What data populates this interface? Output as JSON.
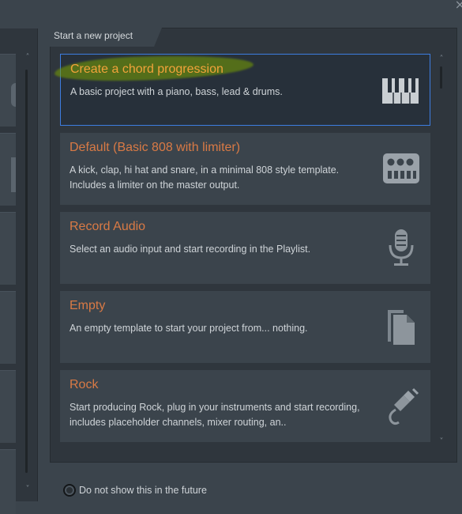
{
  "window": {
    "close_glyph": "×"
  },
  "panel": {
    "tab_title": "Start a new project"
  },
  "templates": [
    {
      "title": "Create a chord progression",
      "description": "A basic project with a piano, bass, lead & drums.",
      "icon": "piano-icon",
      "selected": true
    },
    {
      "title": "Default (Basic 808 with limiter)",
      "description": "A kick, clap, hi hat and snare, in a minimal 808 style template. Includes a limiter on the master output.",
      "icon": "drum-machine-icon",
      "selected": false
    },
    {
      "title": "Record Audio",
      "description": "Select an audio input and start recording in the Playlist.",
      "icon": "microphone-icon",
      "selected": false
    },
    {
      "title": "Empty",
      "description": "An empty template to start your project from... nothing.",
      "icon": "document-icon",
      "selected": false
    },
    {
      "title": "Rock",
      "description": "Start producing Rock, plug in your instruments and start recording, includes placeholder channels, mixer routing, an..",
      "icon": "guitar-jack-icon",
      "selected": false
    }
  ],
  "scroll": {
    "up_glyph": "˄",
    "down_glyph": "˅"
  },
  "footer": {
    "dont_show_label": "Do not show this in the future"
  },
  "colors": {
    "background": "#3b444c",
    "panel": "#2f363d",
    "card": "#3b444c",
    "selected_card": "#27303a",
    "selected_border": "#3d7de0",
    "title_orange": "#d97a45",
    "selected_title": "#f2a33a"
  }
}
